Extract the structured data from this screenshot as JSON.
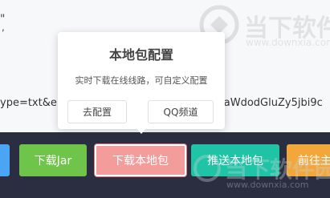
{
  "background": {
    "fragment_quote": "\"",
    "fragment_comma": ",",
    "url_left": "ype=txt&e",
    "url_right": "saWdodGluZy5jbi9c"
  },
  "popover": {
    "title": "本地包配置",
    "description": "实时下载在线线路，可自定义配置",
    "configure_label": "去配置",
    "qq_label": "QQ频道"
  },
  "buttons": {
    "download_jar": "下载Jar",
    "download_local": "下载本地包",
    "push_local": "推送本地包",
    "goto": "前往主"
  },
  "watermark": {
    "cn": "当下软件园",
    "en": "www.downxia.com"
  },
  "colors": {
    "blue": "#4aa6f5",
    "green": "#6fc54a",
    "pink": "#f39c9c",
    "teal": "#1fc3a6",
    "orange": "#f1a73a",
    "bar": "#2a2e40"
  }
}
